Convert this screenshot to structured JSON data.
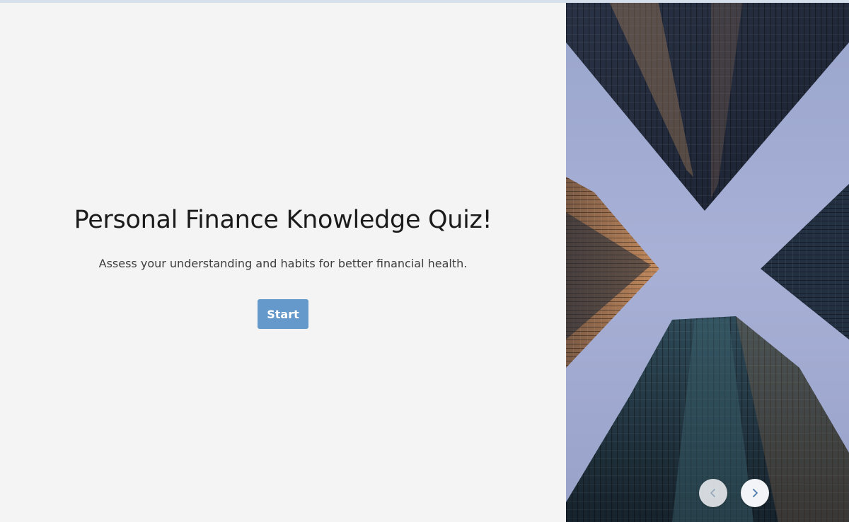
{
  "quiz": {
    "title": "Personal Finance Knowledge Quiz!",
    "subtitle": "Assess your understanding and habits for better financial health.",
    "start_label": "Start"
  },
  "progress": {
    "value": 0
  },
  "gallery": {
    "image_icon": "skyscrapers-photo",
    "prev_icon": "chevron-left-icon",
    "next_icon": "chevron-right-icon",
    "prev_enabled": false,
    "next_enabled": true
  },
  "colors": {
    "accent": "#6598cb",
    "background": "#f4f4f4",
    "progress_track": "#d6e0ec",
    "title_text": "#1b1b1b"
  }
}
